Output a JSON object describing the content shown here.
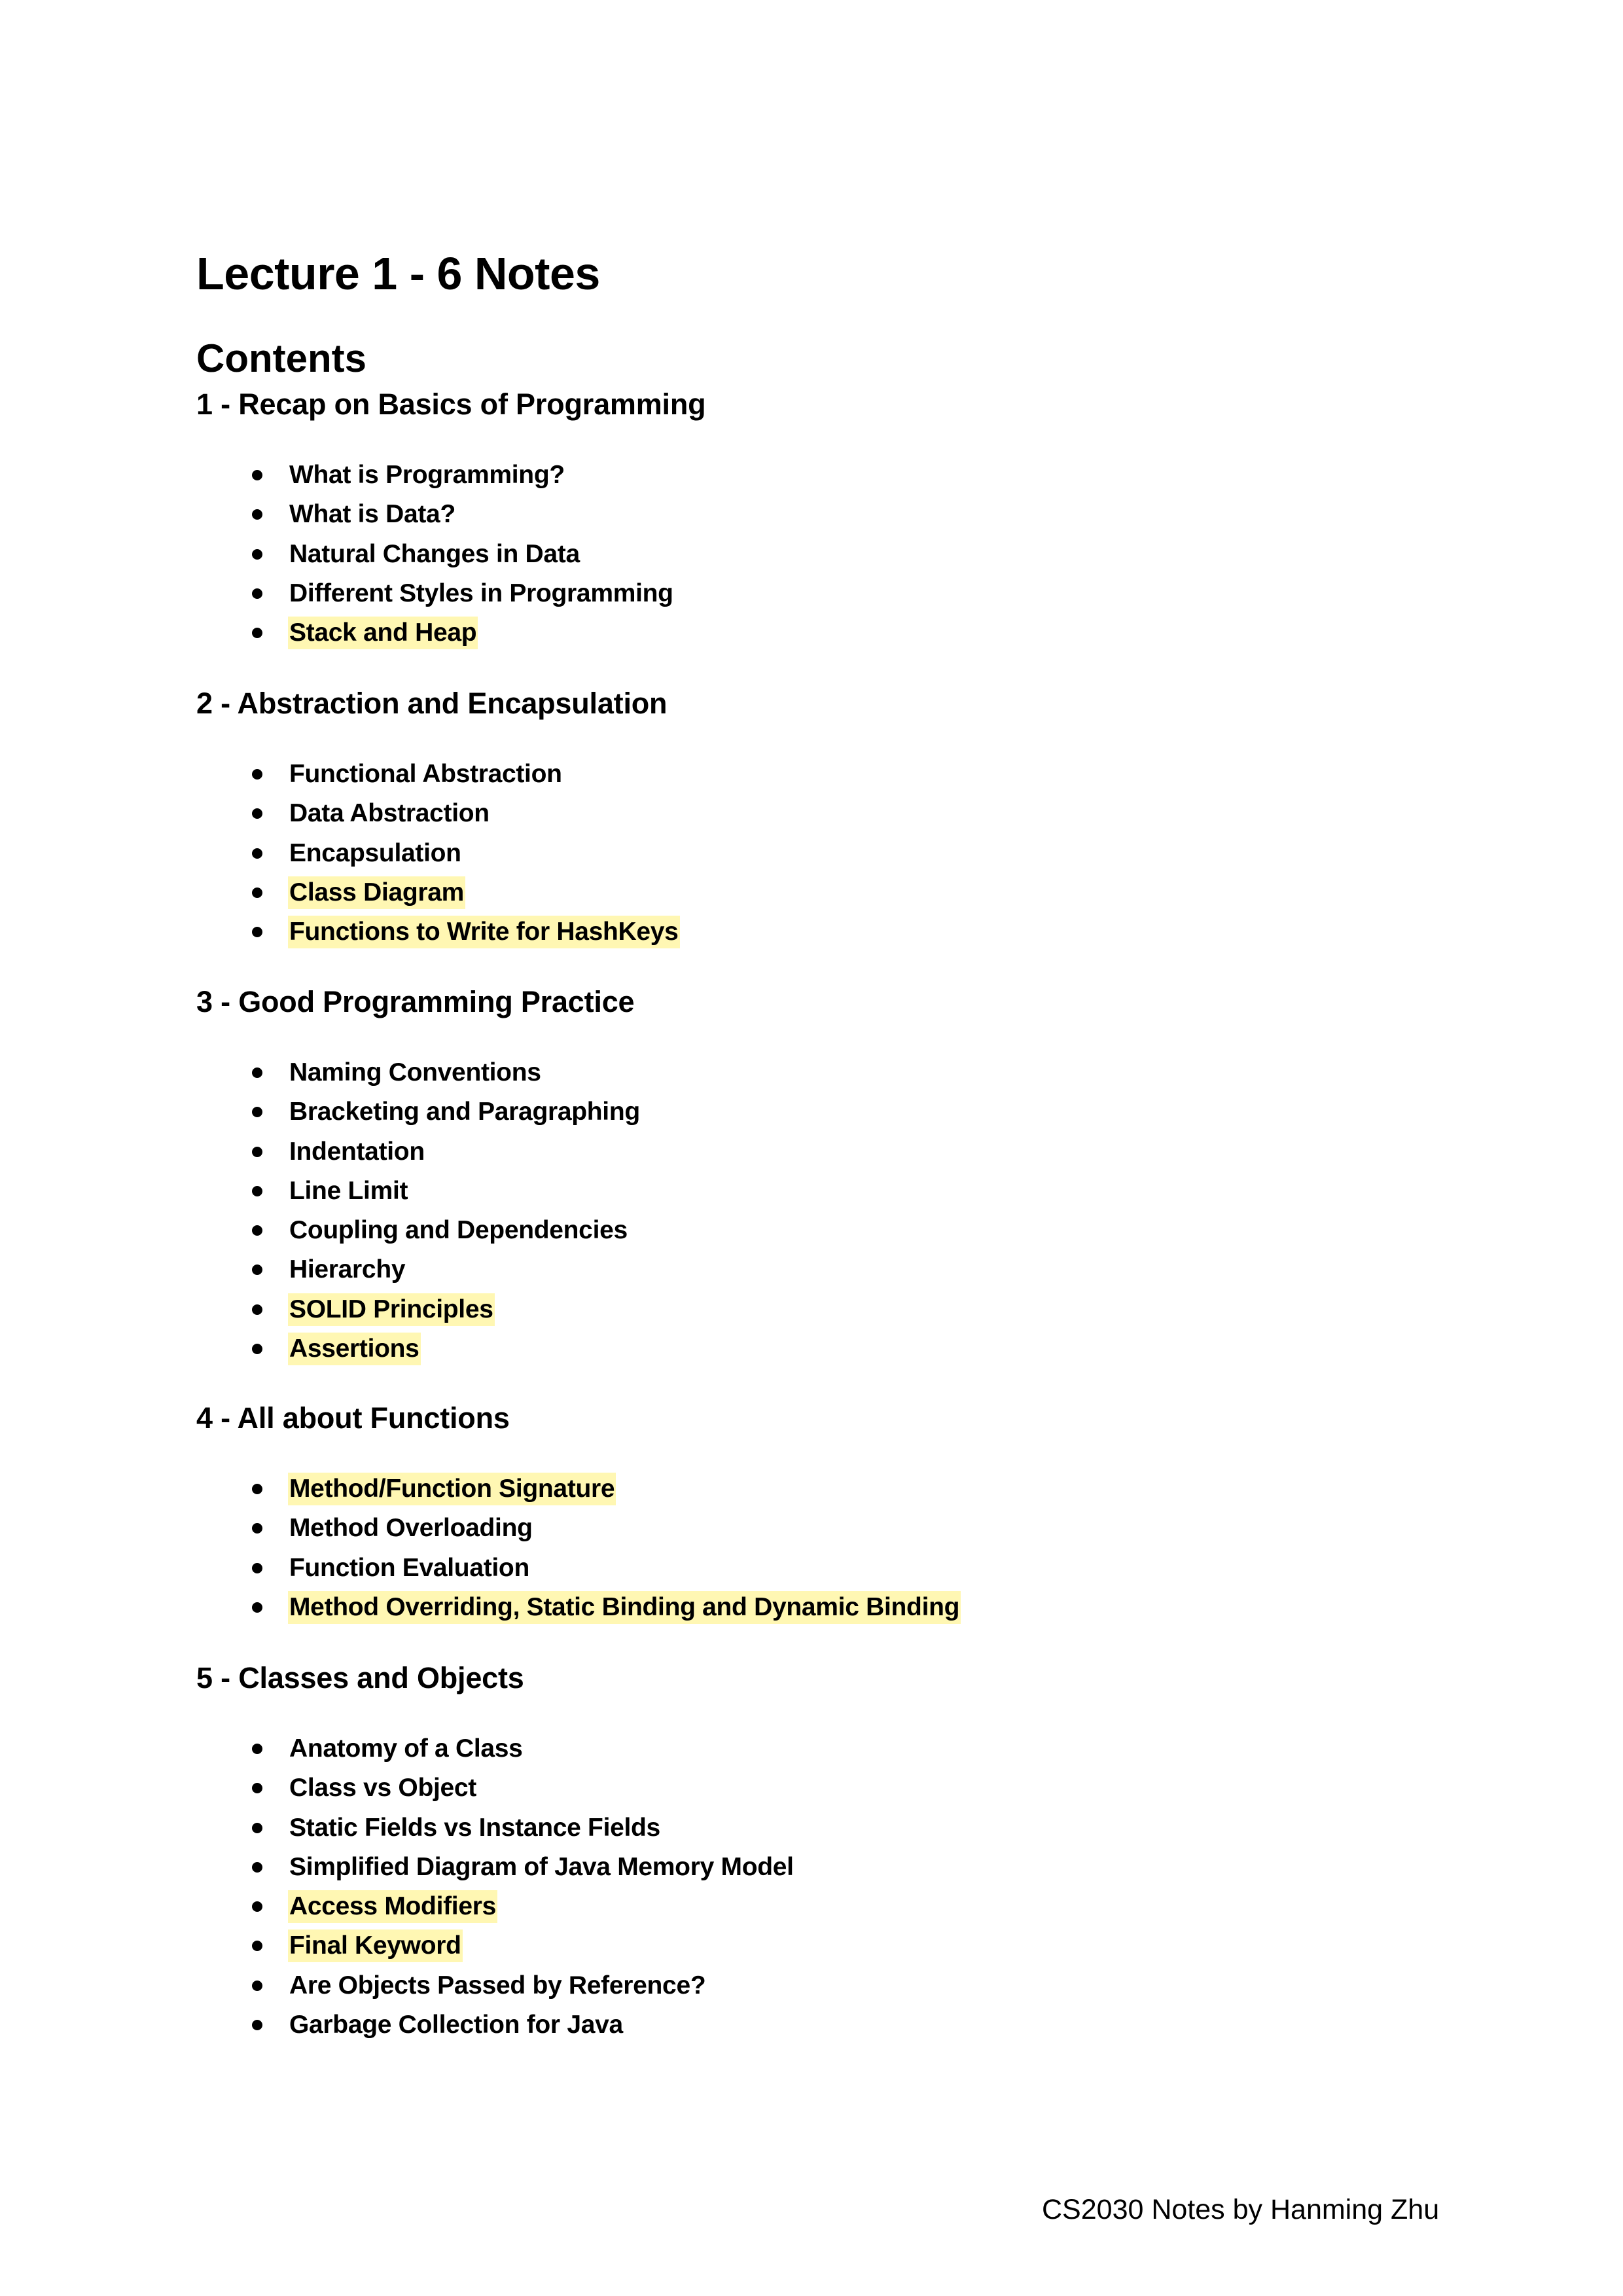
{
  "document": {
    "title": "Lecture 1 - 6 Notes",
    "contents_heading": "Contents",
    "highlight_color": "#fff7b3",
    "footer": "CS2030 Notes by Hanming Zhu"
  },
  "sections": [
    {
      "heading": "1 - Recap on Basics of Programming",
      "items": [
        {
          "label": "What is Programming?",
          "highlighted": false
        },
        {
          "label": "What is Data?",
          "highlighted": false
        },
        {
          "label": "Natural Changes in Data",
          "highlighted": false
        },
        {
          "label": "Different Styles in Programming",
          "highlighted": false
        },
        {
          "label": "Stack and Heap",
          "highlighted": true
        }
      ]
    },
    {
      "heading": "2 - Abstraction and Encapsulation",
      "items": [
        {
          "label": "Functional Abstraction",
          "highlighted": false
        },
        {
          "label": "Data Abstraction",
          "highlighted": false
        },
        {
          "label": "Encapsulation",
          "highlighted": false
        },
        {
          "label": "Class Diagram",
          "highlighted": true
        },
        {
          "label": "Functions to Write for HashKeys",
          "highlighted": true
        }
      ]
    },
    {
      "heading": "3 - Good Programming Practice",
      "items": [
        {
          "label": "Naming Conventions",
          "highlighted": false
        },
        {
          "label": "Bracketing and Paragraphing",
          "highlighted": false
        },
        {
          "label": "Indentation",
          "highlighted": false
        },
        {
          "label": "Line Limit",
          "highlighted": false
        },
        {
          "label": "Coupling and Dependencies",
          "highlighted": false
        },
        {
          "label": "Hierarchy",
          "highlighted": false
        },
        {
          "label": "SOLID Principles",
          "highlighted": true
        },
        {
          "label": "Assertions",
          "highlighted": true
        }
      ]
    },
    {
      "heading": "4 - All about Functions",
      "items": [
        {
          "label": "Method/Function Signature",
          "highlighted": true
        },
        {
          "label": "Method Overloading",
          "highlighted": false
        },
        {
          "label": "Function Evaluation",
          "highlighted": false
        },
        {
          "label": "Method Overriding, Static Binding and Dynamic Binding",
          "highlighted": true
        }
      ]
    },
    {
      "heading": "5 - Classes and Objects",
      "items": [
        {
          "label": "Anatomy of a Class",
          "highlighted": false
        },
        {
          "label": "Class vs Object",
          "highlighted": false
        },
        {
          "label": "Static Fields vs Instance Fields",
          "highlighted": false
        },
        {
          "label": "Simplified Diagram of Java Memory Model",
          "highlighted": false
        },
        {
          "label": "Access Modifiers",
          "highlighted": true
        },
        {
          "label": "Final Keyword",
          "highlighted": true
        },
        {
          "label": "Are Objects Passed by Reference?",
          "highlighted": false
        },
        {
          "label": "Garbage Collection for Java",
          "highlighted": false
        }
      ]
    }
  ]
}
